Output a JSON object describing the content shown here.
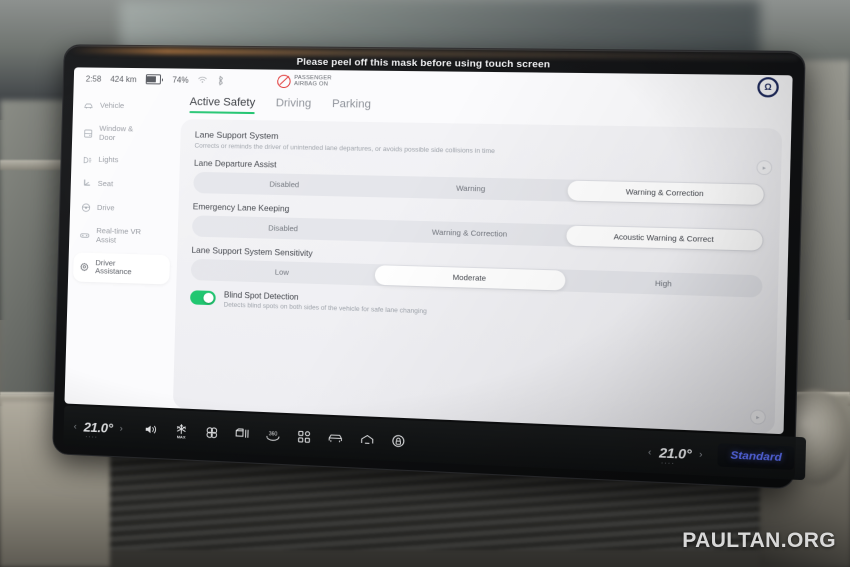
{
  "bezel": {
    "mask_banner": "Please peel off this mask before using touch screen"
  },
  "statusbar": {
    "clock": "2:58",
    "range": "424 km",
    "battery_percent": "74%",
    "wifi_icon": "wifi-icon",
    "bluetooth_icon": "bluetooth-icon",
    "airbag_line1": "PASSENGER",
    "airbag_line2": "AIRBAG ON",
    "airbag_icon": "airbag-off-icon",
    "logo": "brand-logo-icon"
  },
  "sidebar": {
    "items": [
      {
        "label": "Vehicle",
        "icon": "car-icon",
        "active": false
      },
      {
        "label": "Window &\nDoor",
        "icon": "window-door-icon",
        "active": false
      },
      {
        "label": "Lights",
        "icon": "lights-icon",
        "active": false
      },
      {
        "label": "Seat",
        "icon": "seat-icon",
        "active": false
      },
      {
        "label": "Drive",
        "icon": "steering-wheel-icon",
        "active": false
      },
      {
        "label": "Real-time VR\nAssist",
        "icon": "vr-assist-icon",
        "active": false
      },
      {
        "label": "Driver\nAssistance",
        "icon": "gear-icon",
        "active": true
      }
    ]
  },
  "tabs": [
    {
      "label": "Active Safety",
      "active": true
    },
    {
      "label": "Driving",
      "active": false
    },
    {
      "label": "Parking",
      "active": false
    }
  ],
  "panel": {
    "section_title": "Lane Support System",
    "section_desc": "Corrects or reminds the driver of unintended lane departures, or avoids possible side collisions in time",
    "groups": [
      {
        "title": "Lane Departure Assist",
        "options": [
          "Disabled",
          "Warning",
          "Warning & Correction"
        ],
        "selected": 2
      },
      {
        "title": "Emergency Lane Keeping",
        "options": [
          "Disabled",
          "Warning & Correction",
          "Acoustic Warning & Correct"
        ],
        "selected": 2
      },
      {
        "title": "Lane Support System Sensitivity",
        "options": [
          "Low",
          "Moderate",
          "High"
        ],
        "selected": 1
      }
    ],
    "toggle": {
      "label": "Blind Spot Detection",
      "desc": "Detects blind spots on both sides of the vehicle for safe lane changing",
      "on": true,
      "on_color": "#16c46a"
    },
    "scroll_buttons": [
      "next-page-icon",
      "next-page-icon"
    ]
  },
  "bottombar": {
    "left_temp": "21.0°",
    "right_temp": "21.0°",
    "prev_icon": "chevron-left-icon",
    "next_icon": "chevron-right-icon",
    "icons": [
      "volume-icon",
      "ac-max-icon",
      "fan-icon",
      "rear-defrost-icon",
      "360-camera-icon",
      "apps-grid-icon",
      "vehicle-front-icon",
      "home-icon",
      "door-lock-icon"
    ],
    "drive_mode": "Standard",
    "drive_mode_color": "#5f73ff"
  },
  "watermark": "PAULTAN.ORG",
  "accent": {
    "tab_underline": "#17c26a",
    "toggle_green": "#16c46a"
  }
}
